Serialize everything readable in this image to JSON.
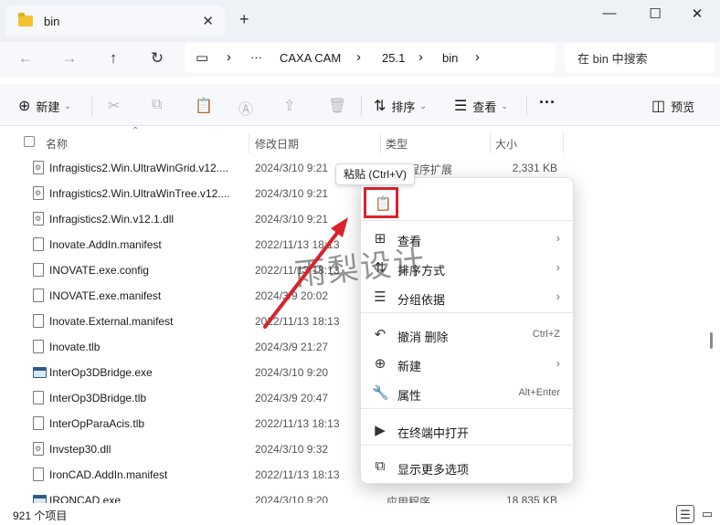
{
  "window": {
    "tab_title": "bin",
    "tab_close": "✕",
    "new_tab": "+",
    "minimize": "—",
    "maximize": "☐",
    "close": "✕"
  },
  "address": {
    "monitor_icon": "▭",
    "chevron": "›",
    "more": "···",
    "crumbs": [
      "CAXA CAM",
      "25.1",
      "bin"
    ],
    "search_placeholder": "在 bin 中搜索"
  },
  "toolbar": {
    "new_label": "新建",
    "sort_label": "排序",
    "view_label": "查看",
    "more_label": "···",
    "preview_label": "预览"
  },
  "columns": {
    "name": "名称",
    "date": "修改日期",
    "type": "类型",
    "size": "大小"
  },
  "files": [
    {
      "name": "Infragistics2.Win.UltraWinGrid.v12....",
      "date": "2024/3/10 9:21",
      "type": "应用程序扩展",
      "size": "2,331 KB",
      "kind": "dll"
    },
    {
      "name": "Infragistics2.Win.UltraWinTree.v12....",
      "date": "2024/3/10 9:21",
      "type": "",
      "size": "",
      "kind": "dll"
    },
    {
      "name": "Infragistics2.Win.v12.1.dll",
      "date": "2024/3/10 9:21",
      "type": "",
      "size": "",
      "kind": "dll"
    },
    {
      "name": "Inovate.AddIn.manifest",
      "date": "2022/11/13 18:13",
      "type": "",
      "size": "",
      "kind": "file"
    },
    {
      "name": "INOVATE.exe.config",
      "date": "2022/11/13 18:13",
      "type": "",
      "size": "",
      "kind": "file"
    },
    {
      "name": "INOVATE.exe.manifest",
      "date": "2024/3/9 20:02",
      "type": "",
      "size": "",
      "kind": "file"
    },
    {
      "name": "Inovate.External.manifest",
      "date": "2022/11/13 18:13",
      "type": "",
      "size": "",
      "kind": "file"
    },
    {
      "name": "Inovate.tlb",
      "date": "2024/3/9 21:27",
      "type": "",
      "size": "",
      "kind": "file"
    },
    {
      "name": "InterOp3DBridge.exe",
      "date": "2024/3/10 9:20",
      "type": "",
      "size": "",
      "kind": "exe"
    },
    {
      "name": "InterOp3DBridge.tlb",
      "date": "2024/3/9 20:47",
      "type": "",
      "size": "",
      "kind": "file"
    },
    {
      "name": "InterOpParaAcis.tlb",
      "date": "2022/11/13 18:13",
      "type": "",
      "size": "",
      "kind": "file"
    },
    {
      "name": "Invstep30.dll",
      "date": "2024/3/10 9:32",
      "type": "",
      "size": "",
      "kind": "dll"
    },
    {
      "name": "IronCAD.AddIn.manifest",
      "date": "2022/11/13 18:13",
      "type": "",
      "size": "",
      "kind": "file"
    },
    {
      "name": "IRONCAD.exe",
      "date": "2024/3/10 9:20",
      "type": "应用程序",
      "size": "18,835 KB",
      "kind": "exe"
    }
  ],
  "status": {
    "item_count": "921 个项目"
  },
  "tooltip": "粘贴 (Ctrl+V)",
  "context_menu": {
    "paste_icon": "📋",
    "items": [
      {
        "icon": "⊞",
        "label": "查看",
        "arrow": "›",
        "shortcut": ""
      },
      {
        "icon": "⇅",
        "label": "排序方式",
        "arrow": "›",
        "shortcut": ""
      },
      {
        "icon": "☰",
        "label": "分组依据",
        "arrow": "›",
        "shortcut": ""
      },
      {
        "icon": "↶",
        "label": "撤消 删除",
        "arrow": "",
        "shortcut": "Ctrl+Z"
      },
      {
        "icon": "⊕",
        "label": "新建",
        "arrow": "›",
        "shortcut": ""
      },
      {
        "icon": "🔧",
        "label": "属性",
        "arrow": "",
        "shortcut": "Alt+Enter"
      },
      {
        "icon": "▶",
        "label": "在终端中打开",
        "arrow": "",
        "shortcut": ""
      },
      {
        "icon": "⧉",
        "label": "显示更多选项",
        "arrow": "",
        "shortcut": ""
      }
    ]
  },
  "watermark": "雨梨设计",
  "colors": {
    "highlight_border": "#d9232a",
    "arrow": "#d9232a",
    "paste_icon": "#1e6fd9"
  }
}
